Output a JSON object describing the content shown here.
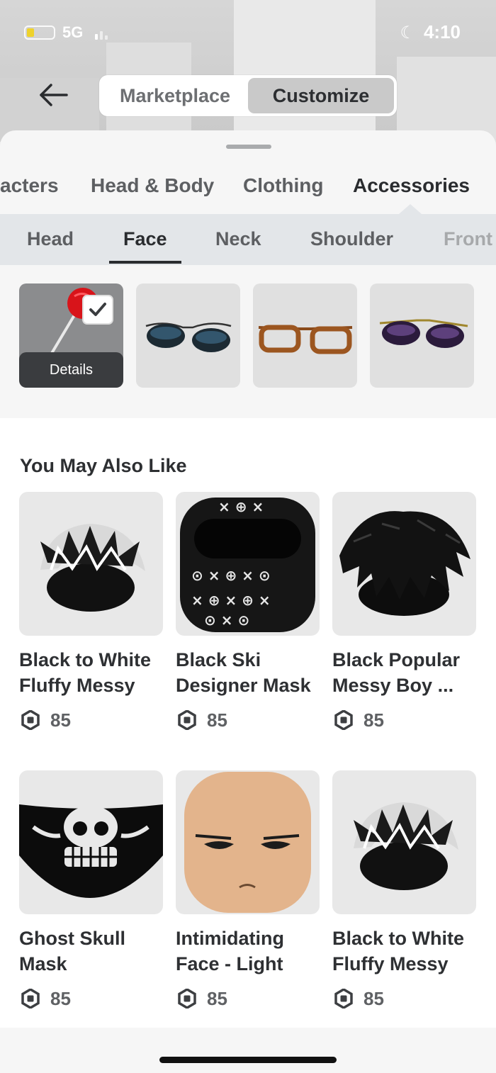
{
  "status_bar": {
    "network": "5G",
    "time": "4:10"
  },
  "header": {
    "tabs": [
      {
        "label": "Marketplace",
        "active": false
      },
      {
        "label": "Customize",
        "active": true
      }
    ]
  },
  "category_tabs": [
    {
      "label": "acters",
      "active": false
    },
    {
      "label": "Head & Body",
      "active": false
    },
    {
      "label": "Clothing",
      "active": false
    },
    {
      "label": "Accessories",
      "active": true
    }
  ],
  "sub_tabs": [
    {
      "label": "Head",
      "active": false
    },
    {
      "label": "Face",
      "active": true
    },
    {
      "label": "Neck",
      "active": false
    },
    {
      "label": "Shoulder",
      "active": false
    },
    {
      "label": "Front",
      "active": false
    }
  ],
  "equipped": {
    "details_label": "Details",
    "items": [
      {
        "icon": "lollipop-icon",
        "selected": true
      },
      {
        "icon": "aviator-sunglasses-icon",
        "selected": false
      },
      {
        "icon": "brown-glasses-icon",
        "selected": false
      },
      {
        "icon": "purple-sunglasses-icon",
        "selected": false
      }
    ]
  },
  "recommendations": {
    "title": "You May Also Like",
    "currency_icon": "robux-icon",
    "items": [
      {
        "name": "Black to White\nFluffy Messy",
        "price": "85",
        "icon": "fluffy-hair-icon"
      },
      {
        "name": "Black Ski\nDesigner Mask",
        "price": "85",
        "icon": "ski-mask-icon"
      },
      {
        "name": "Black Popular\nMessy Boy ...",
        "price": "85",
        "icon": "messy-hair-icon"
      },
      {
        "name": "Ghost Skull\nMask",
        "price": "85",
        "icon": "skull-mask-icon"
      },
      {
        "name": "Intimidating\nFace - Light",
        "price": "85",
        "icon": "face-head-icon"
      },
      {
        "name": "Black to White\nFluffy Messy",
        "price": "85",
        "icon": "fluffy-hair-icon"
      }
    ]
  },
  "colors": {
    "accent": "#2a2c2f",
    "sheet": "#f6f6f6",
    "tile": "#e8e8e8"
  }
}
